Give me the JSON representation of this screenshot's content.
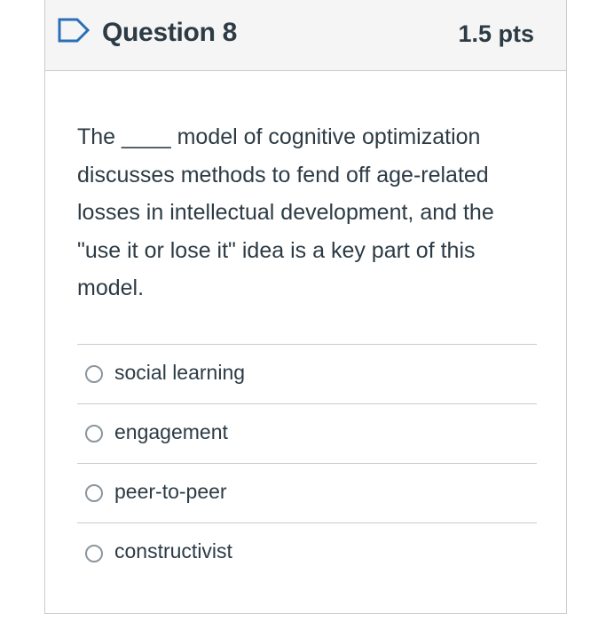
{
  "question": {
    "title": "Question 8",
    "points": "1.5 pts",
    "text": "The ____ model of cognitive optimization discusses methods to fend off age-related losses in intellectual development, and the \"use it or lose it\" idea is a key part of this model.",
    "flag_icon": "bookmark-flag-icon"
  },
  "answers": [
    {
      "label": "social learning",
      "selected": false
    },
    {
      "label": "engagement",
      "selected": false
    },
    {
      "label": "peer-to-peer",
      "selected": false
    },
    {
      "label": "constructivist",
      "selected": false
    }
  ],
  "colors": {
    "text": "#2d3b45",
    "border": "#c7cdd1",
    "header_bg": "#f5f5f5",
    "flag_stroke": "#2b6fb8",
    "radio_border": "#8b969e"
  }
}
